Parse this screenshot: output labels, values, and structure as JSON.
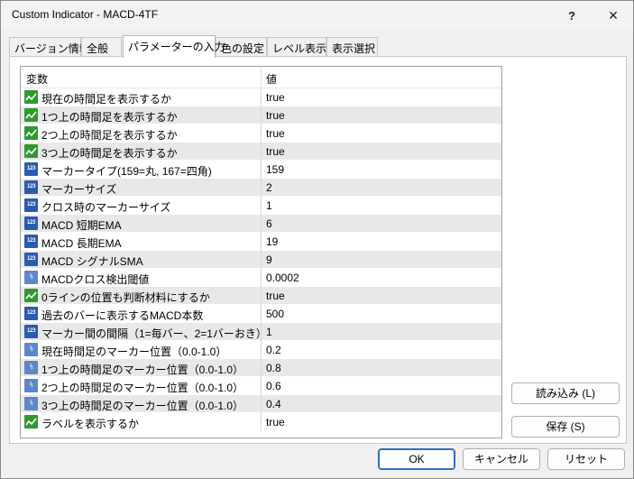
{
  "window": {
    "title": "Custom Indicator - MACD-4TF",
    "help_label": "?",
    "close_label": "✕"
  },
  "tabs": [
    {
      "label": "バージョン情報",
      "active": false
    },
    {
      "label": "全般",
      "active": false
    },
    {
      "label": "パラメーターの入力",
      "active": true
    },
    {
      "label": "色の設定",
      "active": false
    },
    {
      "label": "レベル表示",
      "active": false
    },
    {
      "label": "表示選択",
      "active": false
    }
  ],
  "grid": {
    "header_name": "変数",
    "header_value": "値",
    "rows": [
      {
        "type": "bool",
        "name": "現在の時間足を表示するか",
        "value": "true"
      },
      {
        "type": "bool",
        "name": "1つ上の時間足を表示するか",
        "value": "true"
      },
      {
        "type": "bool",
        "name": "2つ上の時間足を表示するか",
        "value": "true"
      },
      {
        "type": "bool",
        "name": "3つ上の時間足を表示するか",
        "value": "true"
      },
      {
        "type": "int",
        "name": "マーカータイプ(159=丸, 167=四角)",
        "value": "159"
      },
      {
        "type": "int",
        "name": "マーカーサイズ",
        "value": "2"
      },
      {
        "type": "int",
        "name": "クロス時のマーカーサイズ",
        "value": "1"
      },
      {
        "type": "int",
        "name": "MACD 短期EMA",
        "value": "6"
      },
      {
        "type": "int",
        "name": "MACD 長期EMA",
        "value": "19"
      },
      {
        "type": "int",
        "name": "MACD シグナルSMA",
        "value": "9"
      },
      {
        "type": "dbl",
        "name": "MACDクロス検出閾値",
        "value": "0.0002"
      },
      {
        "type": "bool",
        "name": "0ラインの位置も判断材料にするか",
        "value": "true"
      },
      {
        "type": "int",
        "name": "過去のバーに表示するMACD本数",
        "value": "500"
      },
      {
        "type": "int",
        "name": "マーカー間の間隔（1=毎バー、2=1バーおき）",
        "value": "1"
      },
      {
        "type": "dbl",
        "name": "現在時間足のマーカー位置（0.0-1.0）",
        "value": "0.2"
      },
      {
        "type": "dbl",
        "name": "1つ上の時間足のマーカー位置（0.0-1.0）",
        "value": "0.8"
      },
      {
        "type": "dbl",
        "name": "2つ上の時間足のマーカー位置（0.0-1.0）",
        "value": "0.6"
      },
      {
        "type": "dbl",
        "name": "3つ上の時間足のマーカー位置（0.0-1.0）",
        "value": "0.4"
      },
      {
        "type": "bool",
        "name": "ラベルを表示するか",
        "value": "true"
      }
    ]
  },
  "icons": {
    "int_label": "123",
    "dbl_label": "½"
  },
  "buttons": {
    "load": "読み込み (L)",
    "save": "保存 (S)",
    "ok": "OK",
    "cancel": "キャンセル",
    "reset": "リセット"
  },
  "colors": {
    "bool_icon": "#2f9a2f",
    "int_icon": "#2a5cae",
    "dbl_icon": "#5d87c9",
    "ok_border": "#2f6fbd"
  }
}
